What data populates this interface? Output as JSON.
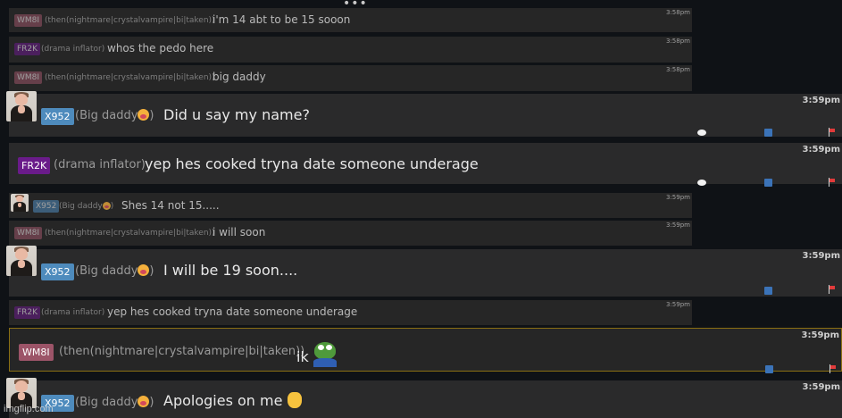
{
  "top_ellipsis": "•••",
  "watermark": "imgflip.com",
  "colors": {
    "WM8I": "#9c5468",
    "FR2K": "#6a1b8a",
    "X952": "#4e8bbd",
    "highlight_border": "#8a6f13"
  },
  "messages": [
    {
      "id": "m1",
      "size": "small",
      "tag": "WM8I",
      "name": "(then(nightmare|crystalvampire|bi|taken))",
      "text": "i'm 14 abt to be 15 sooon",
      "time": "3:58pm"
    },
    {
      "id": "m2",
      "size": "small",
      "tag": "FR2K",
      "name": "(drama inflator)",
      "text": "whos the pedo here",
      "time": "3:58pm"
    },
    {
      "id": "m3",
      "size": "small",
      "tag": "WM8I",
      "name": "(then(nightmare|crystalvampire|bi|taken))",
      "text": "big daddy",
      "time": "3:58pm"
    },
    {
      "id": "m4",
      "size": "big",
      "tag": "X952",
      "name": "(Big daddy",
      "name_emoji": "drooling-face-emoji",
      "name_end": ")",
      "text": "Did u say my name?",
      "time": "3:59pm",
      "avatar": true
    },
    {
      "id": "m5",
      "size": "big",
      "tag": "FR2K",
      "name": "(drama inflator)",
      "text": "yep hes cooked tryna date someone underage",
      "time": "3:59pm"
    },
    {
      "id": "m6",
      "size": "small",
      "tag": "X952",
      "name": "(Big daddy",
      "name_emoji": "drooling-face-emoji",
      "name_end": ")",
      "text": "Shes 14 not 15.....",
      "time": "3:59pm",
      "avatar": true
    },
    {
      "id": "m7",
      "size": "small",
      "tag": "WM8I",
      "name": "(then(nightmare|crystalvampire|bi|taken))",
      "text": "i will soon",
      "time": "3:59pm"
    },
    {
      "id": "m8",
      "size": "big",
      "tag": "X952",
      "name": "(Big daddy",
      "name_emoji": "drooling-face-emoji",
      "name_end": ")",
      "text": "I will be 19 soon....",
      "time": "3:59pm",
      "avatar": true
    },
    {
      "id": "m9",
      "size": "small",
      "tag": "FR2K",
      "name": "(drama inflator)",
      "text": "yep hes cooked tryna date someone underage",
      "time": "3:59pm"
    },
    {
      "id": "m10",
      "size": "big",
      "tag": "WM8I",
      "name": "(then(nightmare|crystalvampire|bi|taken))",
      "text": "ik",
      "text_emoji": "pepe-frog-emoji",
      "time": "3:59pm",
      "highlighted": true
    },
    {
      "id": "m11",
      "size": "big",
      "tag": "X952",
      "name": "(Big daddy",
      "name_emoji": "drooling-face-emoji",
      "name_end": ")",
      "text": "Apologies on me",
      "text_emoji": "raised-hand-emoji",
      "time": "3:59pm",
      "avatar": true
    }
  ]
}
